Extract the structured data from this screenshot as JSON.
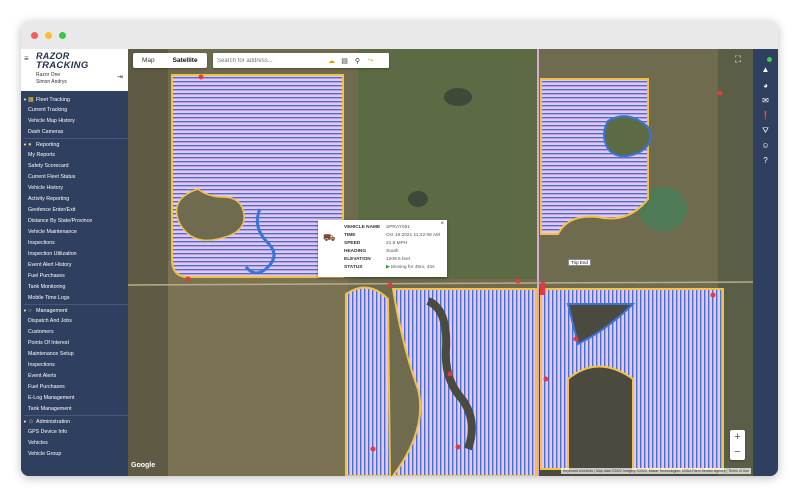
{
  "brand": {
    "line1": "RAZOR",
    "line2": "TRACKING"
  },
  "account": {
    "company": "Razor One",
    "user": "Simon Andrys"
  },
  "sections": [
    {
      "label": "Fleet Tracking",
      "icon": "map-icon",
      "items": [
        "Current Tracking",
        "Vehicle Map History",
        "Dash Cameras"
      ]
    },
    {
      "label": "Reporting",
      "icon": "reports-icon",
      "items": [
        "My Reports",
        "Safety Scorecard",
        "Current Fleet Status",
        "Vehicle History",
        "Activity Reporting",
        "Geofence Enter/Exit",
        "Distance By State/Province",
        "Vehicle Maintenance",
        "Inspections",
        "Inspection Utilization",
        "Event Alert History",
        "Fuel Purchases",
        "Tank Monitoring",
        "Mobile Time Logs"
      ]
    },
    {
      "label": "Management",
      "icon": "management-icon",
      "items": [
        "Dispatch And Jobs",
        "Customers",
        "Points Of Interest",
        "Maintenance Setup",
        "Inspections",
        "Event Alerts",
        "Fuel Purchases",
        "E-Log Management",
        "Tank Management"
      ]
    },
    {
      "label": "Administration",
      "icon": "admin-icon",
      "items": [
        "GPS Device Info",
        "Vehicles",
        "Vehicle Group"
      ]
    }
  ],
  "map": {
    "tab_map": "Map",
    "tab_satellite": "Satellite",
    "active_tab": "Satellite",
    "search_placeholder": "Search for address...",
    "tools": [
      "weather-icon",
      "layers-icon",
      "pin-icon",
      "route-icon"
    ],
    "google_label": "Google",
    "attribution": "Keyboard shortcuts | Map data ©2022 Imagery ©2022, Maxar Technologies, USDA Farm Service Agency | Terms of Use",
    "trip_end_label": "Trip End",
    "zoom_in": "+",
    "zoom_out": "−"
  },
  "popup": {
    "rows": [
      {
        "key": "VEHICLE NAME",
        "value": "SPRAY051"
      },
      {
        "key": "TIME",
        "value": "Oct 18 2021 11:42:06 AM"
      },
      {
        "key": "SPEED",
        "value": "21.6 MPH"
      },
      {
        "key": "HEADING",
        "value": "South"
      },
      {
        "key": "ELEVATION",
        "value": "1209.6 feet"
      },
      {
        "key": "STATUS",
        "value": "Moving for 45m, 43s"
      }
    ]
  },
  "rail_icons": [
    "online-status-icon",
    "warning-triangle-icon",
    "pie-chart-icon",
    "mail-icon",
    "alert-icon",
    "road-icon",
    "smiley-icon",
    "help-icon"
  ],
  "colors": {
    "sidebar": "#2f3f5f",
    "accent": "#f3c243",
    "track_blue": "#3b74d6",
    "track_pink": "#e9a6dc"
  }
}
